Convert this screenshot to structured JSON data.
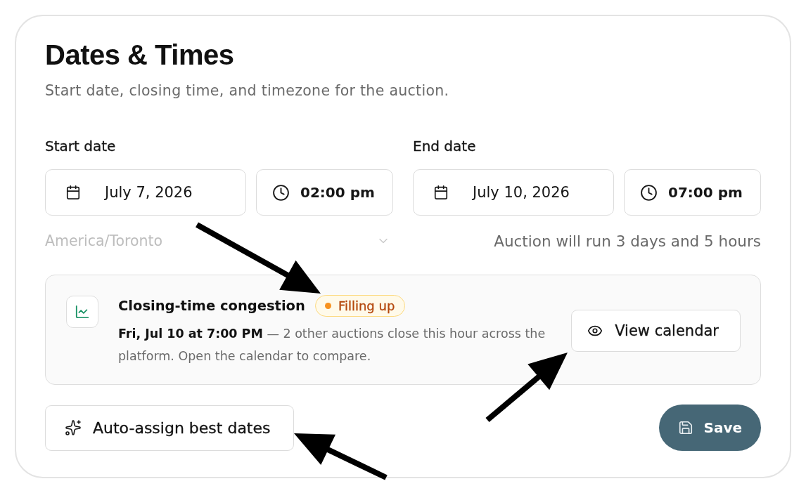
{
  "header": {
    "title": "Dates & Times",
    "subtitle": "Start date, closing time, and timezone for the auction."
  },
  "start": {
    "label": "Start date",
    "date": "July 7, 2026",
    "time": "02:00 pm"
  },
  "end": {
    "label": "End date",
    "date": "July 10, 2026",
    "time": "07:00 pm"
  },
  "timezone": {
    "value": "America/Toronto",
    "disabled": true
  },
  "duration_note": "Auction will run 3 days and 5 hours",
  "congestion": {
    "title": "Closing-time congestion",
    "badge": "Filling up",
    "message": "**Fri, Jul 10 at 7:00 PM** — 2 other auctions close this hour across the platform. Open the calendar to compare.",
    "action": "View calendar"
  },
  "actions": {
    "auto_assign": "Auto-assign best dates",
    "save": "Save"
  }
}
